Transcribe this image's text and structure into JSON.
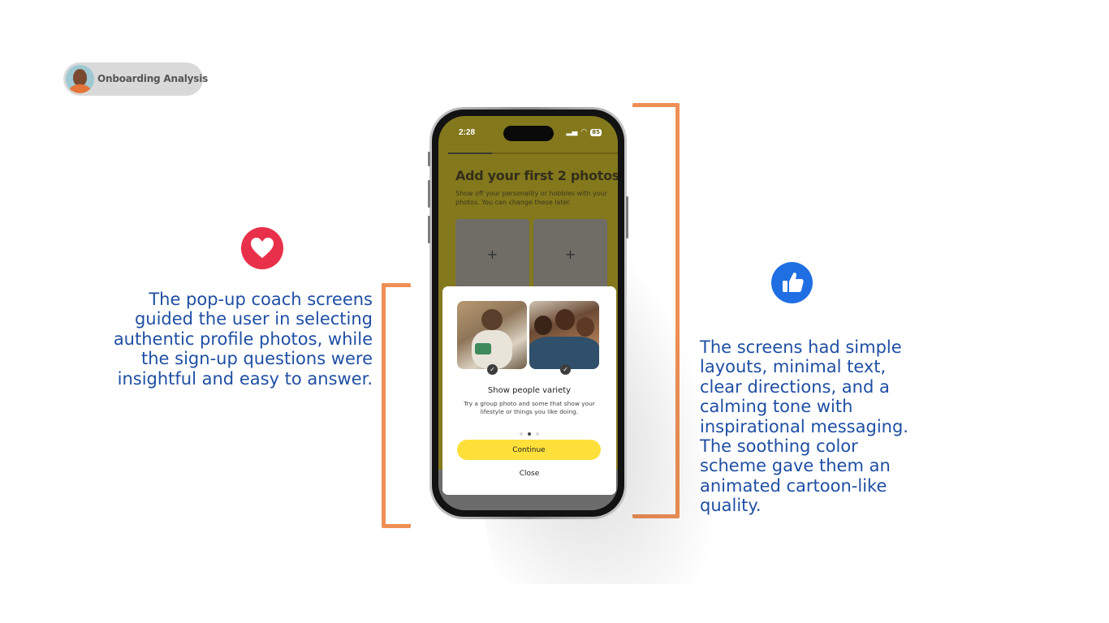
{
  "badge": {
    "label": "Onboarding Analysis"
  },
  "left_caption": {
    "lines": [
      "The pop-up coach screens",
      "guided the user in selecting",
      "authentic profile photos, while",
      "the sign-up questions were",
      "insightful and easy to answer."
    ]
  },
  "right_caption": {
    "lines": [
      "The screens had simple",
      "layouts, minimal text,",
      "clear directions, and a",
      "calming tone with",
      "inspirational messaging.",
      "The soothing color",
      "scheme gave them an",
      "animated cartoon-like",
      "quality."
    ]
  },
  "icons": {
    "left": "heart-icon",
    "right": "thumbs-up-icon"
  },
  "colors": {
    "accent_orange": "#ee8f55",
    "caption_blue": "#1f4fa3",
    "heart_red": "#e8304a",
    "like_blue": "#1f6fe3",
    "button_yellow": "#ffe03a"
  },
  "phone": {
    "status": {
      "time": "2:28",
      "battery": "85"
    },
    "onboarding_progress": 0.25,
    "screen": {
      "title": "Add your first 2 photos",
      "subtitle": "Show off your personality or hobbies with your photos. You can change these later.",
      "slot_symbol": "+"
    },
    "coach": {
      "title": "Show people variety",
      "body": "Try a group photo and some that show your lifestyle or things you like doing.",
      "page": 2,
      "page_count": 3,
      "continue_label": "Continue",
      "close_label": "Close"
    }
  }
}
